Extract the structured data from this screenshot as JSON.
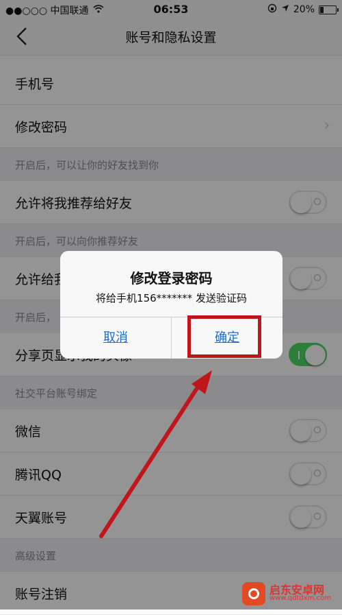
{
  "status_bar": {
    "carrier": "●●○○○ 中国联通",
    "time": "06:53",
    "battery_text": "20%",
    "battery_level": 0.2
  },
  "nav": {
    "title": "账号和隐私设置"
  },
  "list": {
    "phone_label": "手机号",
    "password_label": "修改密码",
    "section1": "开启后，可以让你的好友找到你",
    "recommend_me_label": "允许将我推荐给好友",
    "section2": "开启后，可以向你推荐好友",
    "recommend_to_me_label": "允许给我推荐好友",
    "section3": "开启后，",
    "share_label": "分享页显示我的头像",
    "social_section": "社交平台账号绑定",
    "wechat_label": "微信",
    "qq_label": "腾讯QQ",
    "tianyi_label": "天翼账号",
    "advanced_section": "高级设置",
    "delete_label": "账号注销"
  },
  "dialog": {
    "title": "修改登录密码",
    "message": "将给手机156*******   发送验证码",
    "cancel": "取消",
    "ok": "确定"
  },
  "watermark": {
    "name": "启东安卓网",
    "url": "www.qdtdxm.com"
  },
  "colors": {
    "accent": "#1a6ccf",
    "toggle_on": "#4cd964",
    "highlight": "#c0151b"
  }
}
